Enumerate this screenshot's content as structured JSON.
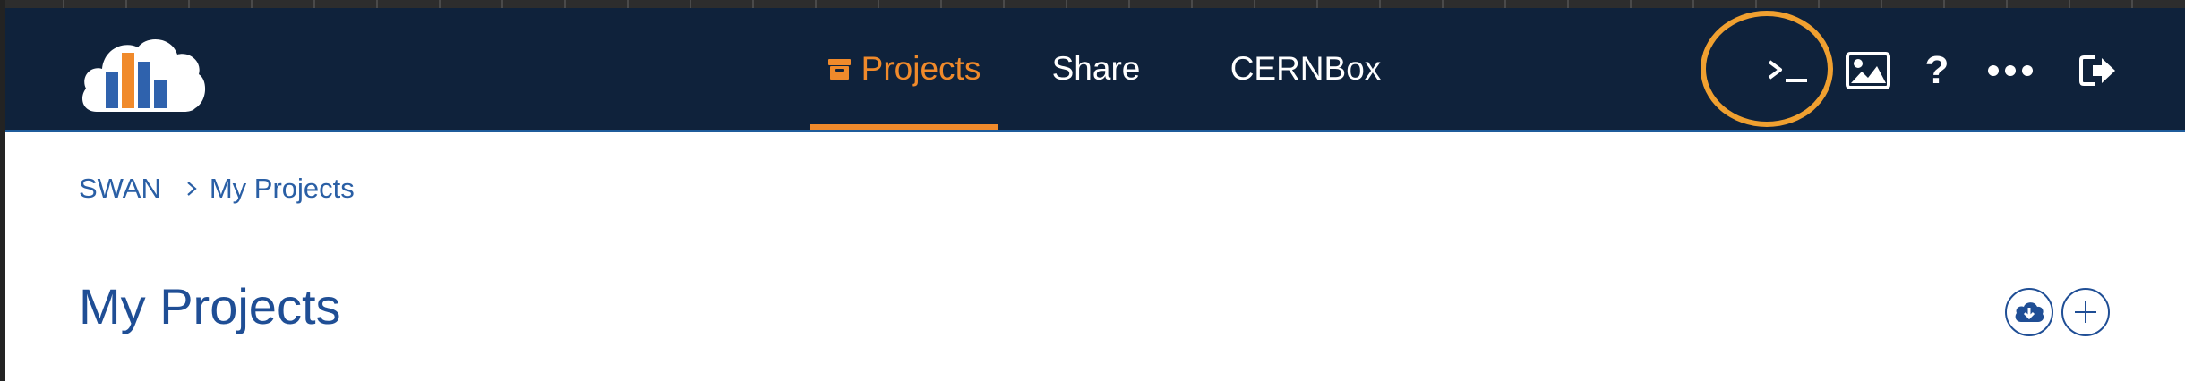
{
  "navbar": {
    "logo_name": "swan-logo",
    "tabs": [
      {
        "label": "Projects",
        "active": true,
        "icon": "archive-icon"
      },
      {
        "label": "Share",
        "active": false
      },
      {
        "label": "CERNBox",
        "active": false
      }
    ],
    "icons": [
      "terminal-icon",
      "image-icon",
      "help-icon",
      "more-icon",
      "logout-icon"
    ],
    "help_glyph": "?"
  },
  "breadcrumb": {
    "root": "SWAN",
    "current": "My Projects"
  },
  "main": {
    "title": "My Projects"
  },
  "colors": {
    "navbar_bg": "#0f223b",
    "accent_orange": "#f08a2b",
    "link_blue": "#2a5fa5",
    "highlight_ring": "#f0a030"
  }
}
